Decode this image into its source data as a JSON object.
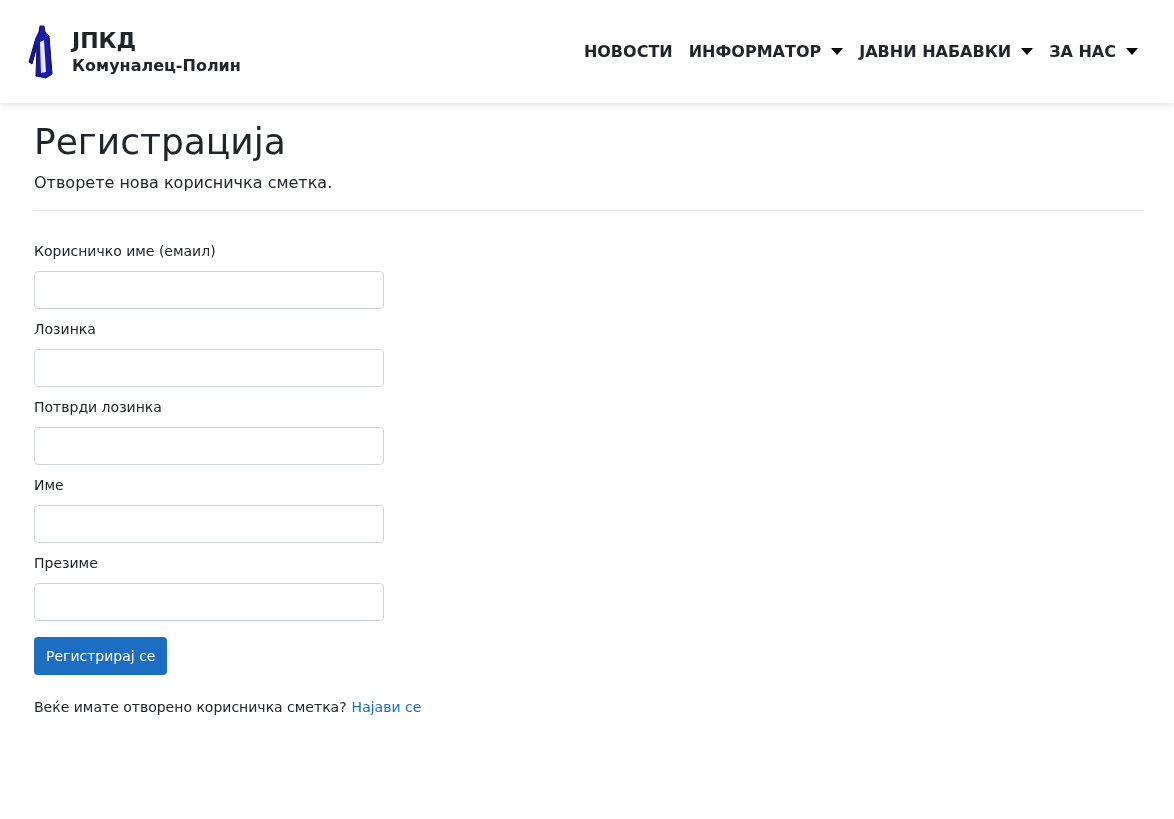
{
  "brand": {
    "title": "ЈПКД",
    "subtitle": "Комуналец-Полин"
  },
  "nav": [
    {
      "label": "НОВОСТИ",
      "dropdown": false
    },
    {
      "label": "ИНФОРМАТОР",
      "dropdown": true
    },
    {
      "label": "ЈАВНИ НАБАВКИ",
      "dropdown": true
    },
    {
      "label": "ЗА НАС",
      "dropdown": true
    }
  ],
  "heading": "Регистрација",
  "subheading": "Отворете нова корисничка сметка.",
  "fields": [
    {
      "label": "Корисничко име (емаил)"
    },
    {
      "label": "Лозинка"
    },
    {
      "label": "Потврди лозинка"
    },
    {
      "label": "Име"
    },
    {
      "label": "Презиме"
    }
  ],
  "submit": "Регистрирај се",
  "login_prompt": {
    "text": "Веќе имате отворено корисничка сметка?",
    "link": "Најави се"
  }
}
